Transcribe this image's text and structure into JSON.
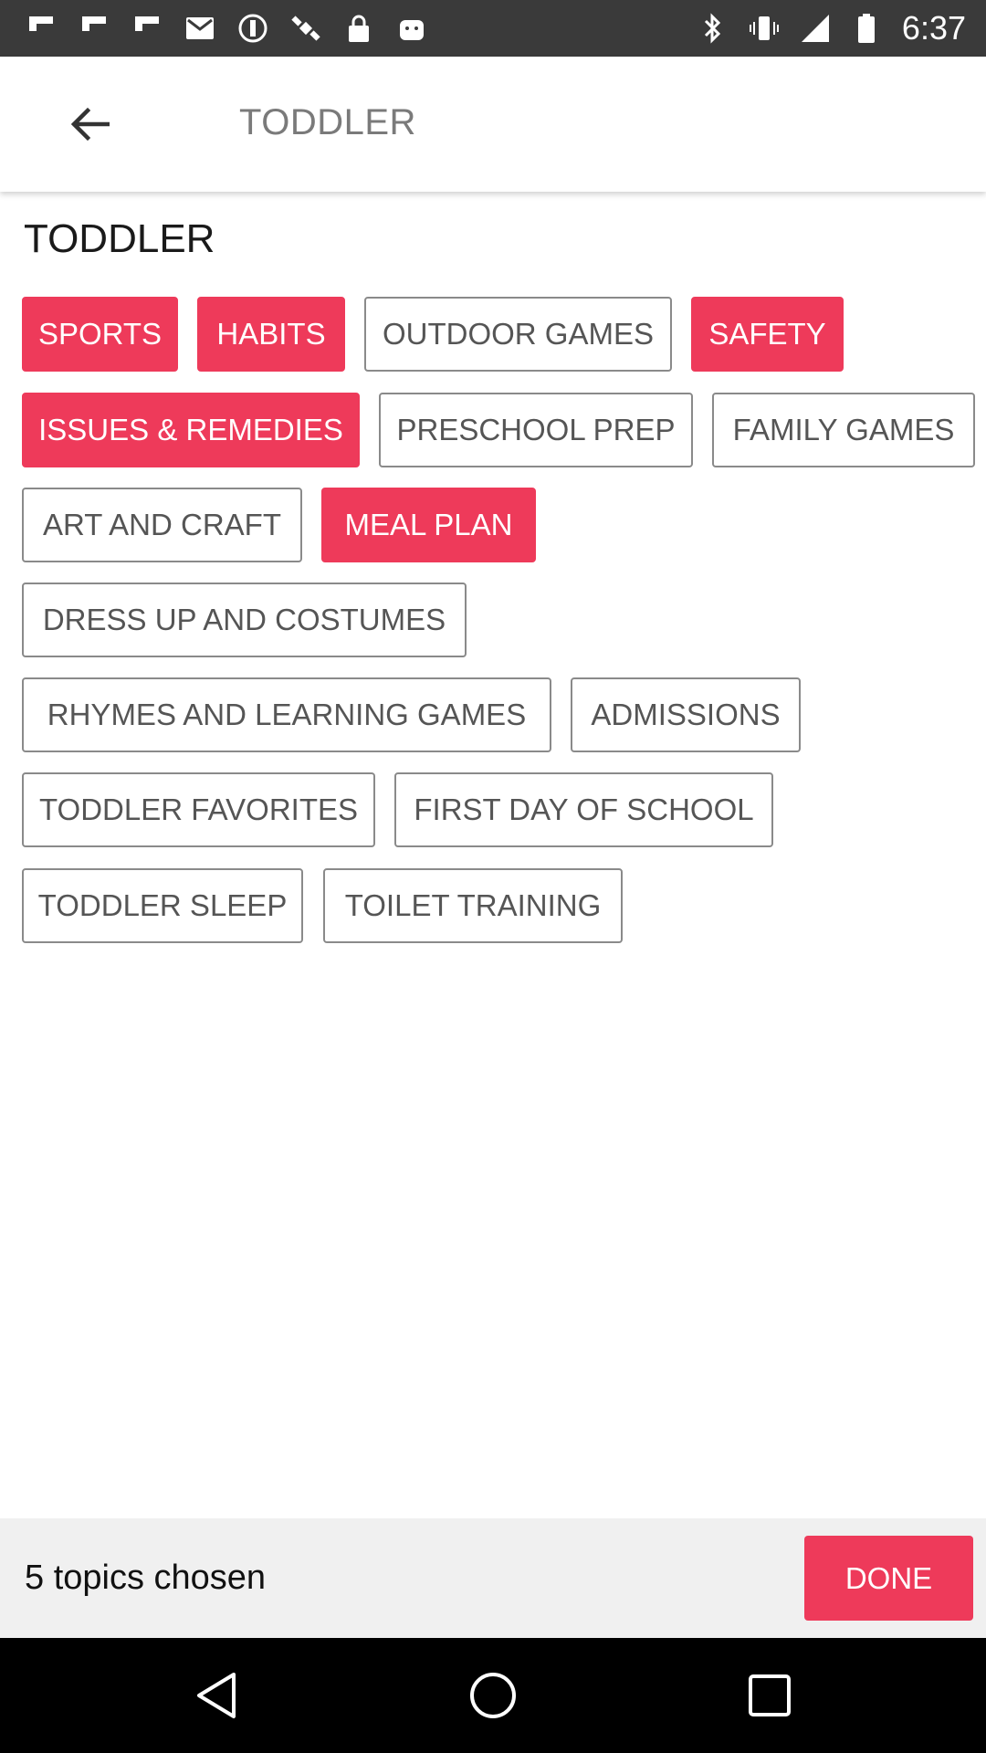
{
  "status_bar": {
    "time": "6:37",
    "left_icons": [
      "flipboard-icon",
      "flipboard-icon",
      "flipboard-icon",
      "email-icon",
      "no-entry-icon",
      "satellite-icon",
      "lock-icon",
      "android-icon"
    ],
    "right_icons": [
      "bluetooth-icon",
      "vibrate-icon",
      "signal-icon",
      "battery-icon"
    ]
  },
  "toolbar": {
    "title": "TODDLER",
    "back_icon": "arrow-left-icon"
  },
  "section": {
    "title": "TODDLER"
  },
  "topics": [
    {
      "label": "SPORTS",
      "selected": true
    },
    {
      "label": "HABITS",
      "selected": true
    },
    {
      "label": "OUTDOOR GAMES",
      "selected": false
    },
    {
      "label": "SAFETY",
      "selected": true
    },
    {
      "label": "ISSUES & REMEDIES",
      "selected": true
    },
    {
      "label": "PRESCHOOL PREP",
      "selected": false
    },
    {
      "label": "FAMILY GAMES",
      "selected": false
    },
    {
      "label": "ART AND CRAFT",
      "selected": false
    },
    {
      "label": "MEAL PLAN",
      "selected": true
    },
    {
      "label": "DRESS UP AND COSTUMES",
      "selected": false
    },
    {
      "label": "RHYMES AND LEARNING GAMES",
      "selected": false
    },
    {
      "label": "ADMISSIONS",
      "selected": false
    },
    {
      "label": "TODDLER FAVORITES",
      "selected": false
    },
    {
      "label": "FIRST DAY OF SCHOOL",
      "selected": false
    },
    {
      "label": "TODDLER SLEEP",
      "selected": false
    },
    {
      "label": "TOILET TRAINING",
      "selected": false
    }
  ],
  "bottom_bar": {
    "count_text": "5 topics chosen",
    "done_label": "DONE"
  },
  "colors": {
    "accent": "#ee3a5a",
    "chip_border": "#8a8a8a",
    "chip_text": "#555555"
  },
  "nav_bar": {
    "icons": [
      "back-triangle-icon",
      "home-circle-icon",
      "recents-square-icon"
    ]
  }
}
